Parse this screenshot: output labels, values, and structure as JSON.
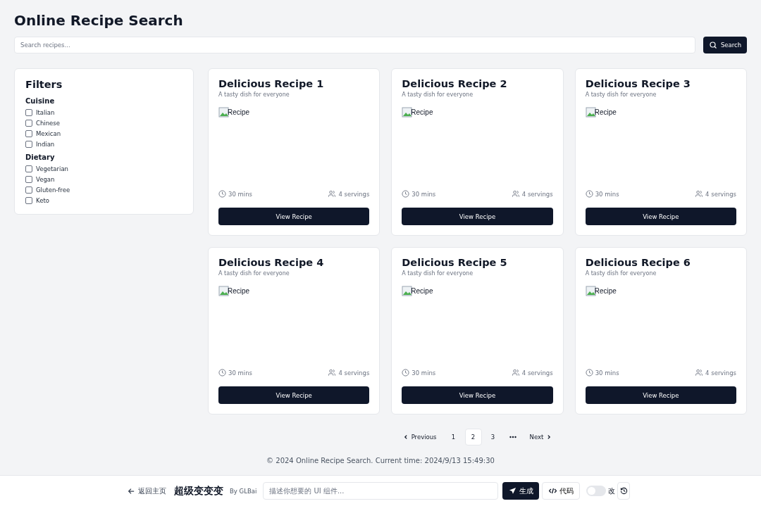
{
  "title": "Online Recipe Search",
  "search": {
    "placeholder": "Search recipes...",
    "button": "Search"
  },
  "filters": {
    "title": "Filters",
    "groups": [
      {
        "title": "Cuisine",
        "options": [
          {
            "label": "Italian",
            "checked": false
          },
          {
            "label": "Chinese",
            "checked": false
          },
          {
            "label": "Mexican",
            "checked": false
          },
          {
            "label": "Indian",
            "checked": false
          }
        ]
      },
      {
        "title": "Dietary",
        "options": [
          {
            "label": "Vegetarian",
            "checked": false
          },
          {
            "label": "Vegan",
            "checked": false
          },
          {
            "label": "Gluten-free",
            "checked": false
          },
          {
            "label": "Keto",
            "checked": false
          }
        ]
      }
    ]
  },
  "recipes": [
    {
      "title": "Delicious Recipe 1",
      "description": "A tasty dish for everyone",
      "image_alt": "Recipe",
      "time": "30 mins",
      "servings": "4 servings",
      "button": "View Recipe"
    },
    {
      "title": "Delicious Recipe 2",
      "description": "A tasty dish for everyone",
      "image_alt": "Recipe",
      "time": "30 mins",
      "servings": "4 servings",
      "button": "View Recipe"
    },
    {
      "title": "Delicious Recipe 3",
      "description": "A tasty dish for everyone",
      "image_alt": "Recipe",
      "time": "30 mins",
      "servings": "4 servings",
      "button": "View Recipe"
    },
    {
      "title": "Delicious Recipe 4",
      "description": "A tasty dish for everyone",
      "image_alt": "Recipe",
      "time": "30 mins",
      "servings": "4 servings",
      "button": "View Recipe"
    },
    {
      "title": "Delicious Recipe 5",
      "description": "A tasty dish for everyone",
      "image_alt": "Recipe",
      "time": "30 mins",
      "servings": "4 servings",
      "button": "View Recipe"
    },
    {
      "title": "Delicious Recipe 6",
      "description": "A tasty dish for everyone",
      "image_alt": "Recipe",
      "time": "30 mins",
      "servings": "4 servings",
      "button": "View Recipe"
    }
  ],
  "pagination": {
    "previous": "Previous",
    "next": "Next",
    "pages": [
      {
        "kind": "page",
        "label": "1",
        "selected": false
      },
      {
        "kind": "page",
        "label": "2",
        "selected": true
      },
      {
        "kind": "page",
        "label": "3",
        "selected": false
      },
      {
        "kind": "ellipsis",
        "selected": false
      }
    ]
  },
  "footer": "© 2024 Online Recipe Search. Current time: 2024/9/13 15:49:30",
  "toolbar": {
    "back": "返回主页",
    "brand": "超级变变变",
    "author": "By GLBai",
    "prompt_placeholder": "描述你想要的 UI 组件...",
    "generate": "生成",
    "code": "代码",
    "toggle_on": false,
    "toggle_label": "改"
  }
}
